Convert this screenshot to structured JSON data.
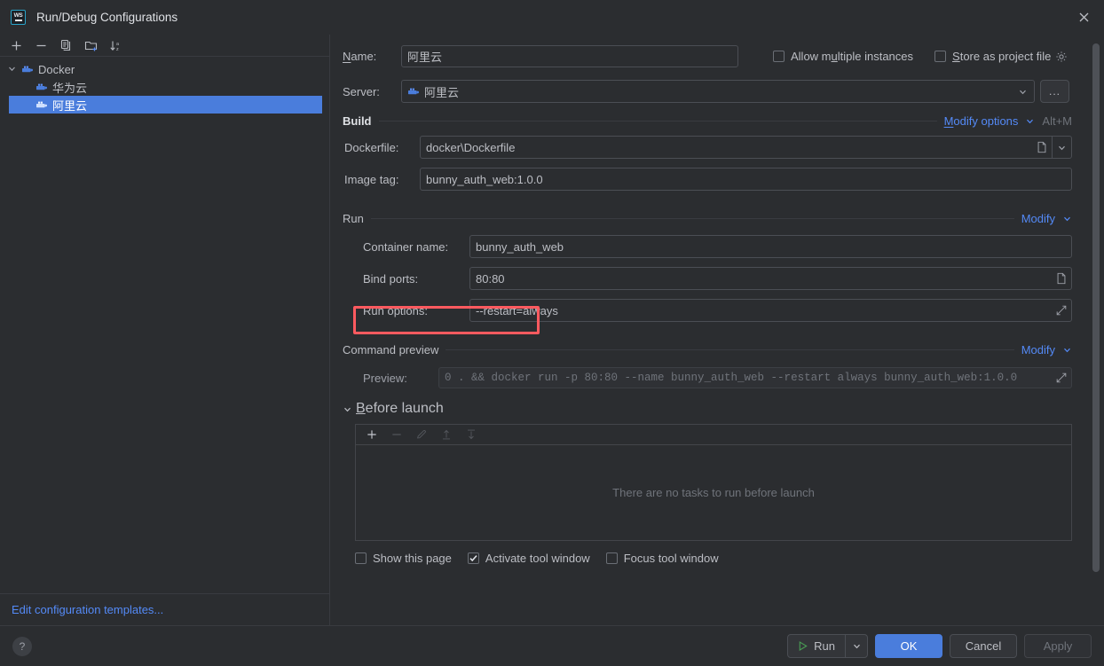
{
  "window": {
    "title": "Run/Debug Configurations",
    "logo_text": "WS",
    "close_icon": "close-icon"
  },
  "colors": {
    "accent": "#4a7ddc",
    "link": "#548af7",
    "highlight": "#ff5a5f",
    "background": "#2b2d30",
    "field_border": "#4b4e54"
  },
  "sidebar": {
    "toolbar": [
      {
        "name": "add-configuration-button",
        "icon": "plus-icon"
      },
      {
        "name": "remove-configuration-button",
        "icon": "minus-icon"
      },
      {
        "name": "copy-configuration-button",
        "icon": "copy-icon"
      },
      {
        "name": "new-folder-button",
        "icon": "new-folder-icon"
      },
      {
        "name": "sort-configurations-button",
        "icon": "sort-alphabetical-icon"
      }
    ],
    "tree": [
      {
        "label": "Docker",
        "icon": "docker-icon",
        "level": 0,
        "expanded": true,
        "selected": false
      },
      {
        "label": "华为云",
        "icon": "docker-icon",
        "level": 1,
        "expanded": false,
        "selected": false
      },
      {
        "label": "阿里云",
        "icon": "docker-icon",
        "level": 1,
        "expanded": false,
        "selected": true
      }
    ],
    "footer_link": "Edit configuration templates..."
  },
  "main": {
    "name_label": "Name:",
    "name_value": "阿里云",
    "allow_multiple_instances": {
      "label": "Allow multiple instances",
      "checked": false
    },
    "store_as_project_file": {
      "label": "Store as project file",
      "checked": false,
      "gear_icon": "gear-icon"
    },
    "server_label": "Server:",
    "server_value": "阿里云",
    "server_icon": "docker-icon",
    "server_browse_label": "...",
    "build_section": {
      "title": "Build",
      "modify_label": "Modify options",
      "shortcut": "Alt+M"
    },
    "dockerfile_label": "Dockerfile:",
    "dockerfile_value": "docker\\Dockerfile",
    "image_tag_label": "Image tag:",
    "image_tag_value": "bunny_auth_web:1.0.0",
    "run_section": {
      "title": "Run",
      "modify_label": "Modify"
    },
    "container_name_label": "Container name:",
    "container_name_value": "bunny_auth_web",
    "bind_ports_label": "Bind ports:",
    "bind_ports_value": "80:80",
    "run_options_label": "Run options:",
    "run_options_value": "--restart=always",
    "command_preview_section": {
      "title": "Command preview",
      "modify_label": "Modify"
    },
    "preview_label": "Preview:",
    "preview_value": "0 . && docker run -p 80:80 --name bunny_auth_web --restart always bunny_auth_web:1.0.0",
    "before_launch": {
      "title": "Before launch",
      "expanded": true,
      "toolbar": [
        {
          "name": "add-task-button",
          "icon": "plus-icon",
          "enabled": true
        },
        {
          "name": "remove-task-button",
          "icon": "minus-icon",
          "enabled": false
        },
        {
          "name": "edit-task-button",
          "icon": "pencil-icon",
          "enabled": false
        },
        {
          "name": "move-task-up-button",
          "icon": "arrow-up-icon",
          "enabled": false
        },
        {
          "name": "move-task-down-button",
          "icon": "arrow-down-icon",
          "enabled": false
        }
      ],
      "empty_message": "There are no tasks to run before launch"
    },
    "bottom_checkboxes": [
      {
        "label": "Show this page",
        "checked": false
      },
      {
        "label": "Activate tool window",
        "checked": true
      },
      {
        "label": "Focus tool window",
        "checked": false
      }
    ]
  },
  "footer": {
    "help_label": "?",
    "run_label": "Run",
    "run_icon": "play-icon",
    "run_dropdown_icon": "chevron-down-icon",
    "ok_label": "OK",
    "cancel_label": "Cancel",
    "apply_label": "Apply",
    "apply_enabled": false
  }
}
